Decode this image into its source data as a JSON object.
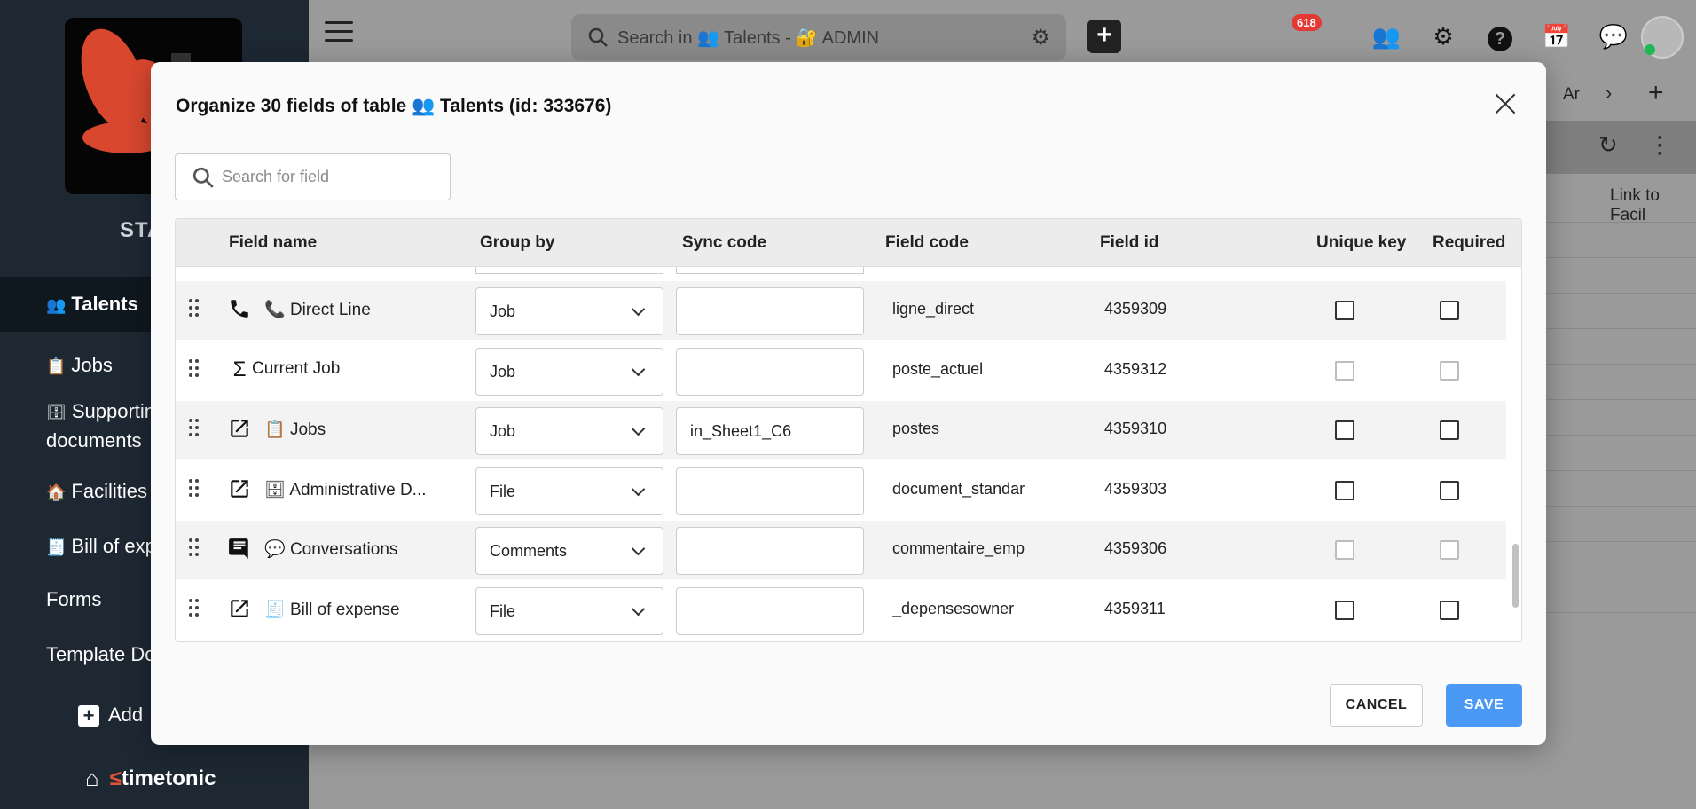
{
  "sidebar": {
    "brand": "STA",
    "items": [
      {
        "icon": "👥",
        "label": "Talents",
        "active": true
      },
      {
        "icon": "📋",
        "label": "Jobs"
      },
      {
        "icon": "🗄",
        "label": "Supporting",
        "label2": "documents"
      },
      {
        "icon": "🏠",
        "label": "Facilities"
      },
      {
        "icon": "🧾",
        "label": "Bill of exp"
      },
      {
        "icon": "",
        "label": "Forms"
      },
      {
        "icon": "",
        "label": "Template Do"
      },
      {
        "icon": "",
        "label": "Add"
      }
    ],
    "footer_logo": "timetonic"
  },
  "topbar": {
    "search_placeholder": "Search in 👥 Talents - 🔐 ADMIN",
    "badge_count": "618"
  },
  "background": {
    "tab_partial": "Ar",
    "link_partial": "Link to Facil"
  },
  "modal": {
    "title": "Organize 30 fields of table 👥 Talents (id: 333676)",
    "search_placeholder": "Search for field",
    "columns": {
      "field_name": "Field name",
      "group_by": "Group by",
      "sync_code": "Sync code",
      "field_code": "Field code",
      "field_id": "Field id",
      "unique_key": "Unique key",
      "required": "Required"
    },
    "rows": [
      {
        "type_icon": "phone-icon",
        "emoji": "📞",
        "name": "Direct Line",
        "group": "Job",
        "sync": "",
        "code": "ligne_direct",
        "id": "4359309",
        "unique_enabled": true,
        "required_enabled": true
      },
      {
        "type_icon": "sigma-icon",
        "emoji": "",
        "name": "Current Job",
        "group": "Job",
        "sync": "",
        "code": "poste_actuel",
        "id": "4359312",
        "unique_enabled": false,
        "required_enabled": false
      },
      {
        "type_icon": "link-icon",
        "emoji": "📋",
        "name": "Jobs",
        "group": "Job",
        "sync": "in_Sheet1_C6",
        "code": "postes",
        "id": "4359310",
        "unique_enabled": true,
        "required_enabled": true
      },
      {
        "type_icon": "link-icon",
        "emoji": "🗄",
        "name": "Administrative D...",
        "group": "File",
        "sync": "",
        "code": "document_standar",
        "id": "4359303",
        "unique_enabled": true,
        "required_enabled": true
      },
      {
        "type_icon": "comment-icon",
        "emoji": "💬",
        "name": "Conversations",
        "group": "Comments",
        "sync": "",
        "code": "commentaire_emp",
        "id": "4359306",
        "unique_enabled": false,
        "required_enabled": false
      },
      {
        "type_icon": "link-icon",
        "emoji": "🧾",
        "name": "Bill of expense",
        "group": "File",
        "sync": "",
        "code": "_depensesowner",
        "id": "4359311",
        "unique_enabled": true,
        "required_enabled": true
      }
    ],
    "cancel_label": "CANCEL",
    "save_label": "SAVE"
  }
}
